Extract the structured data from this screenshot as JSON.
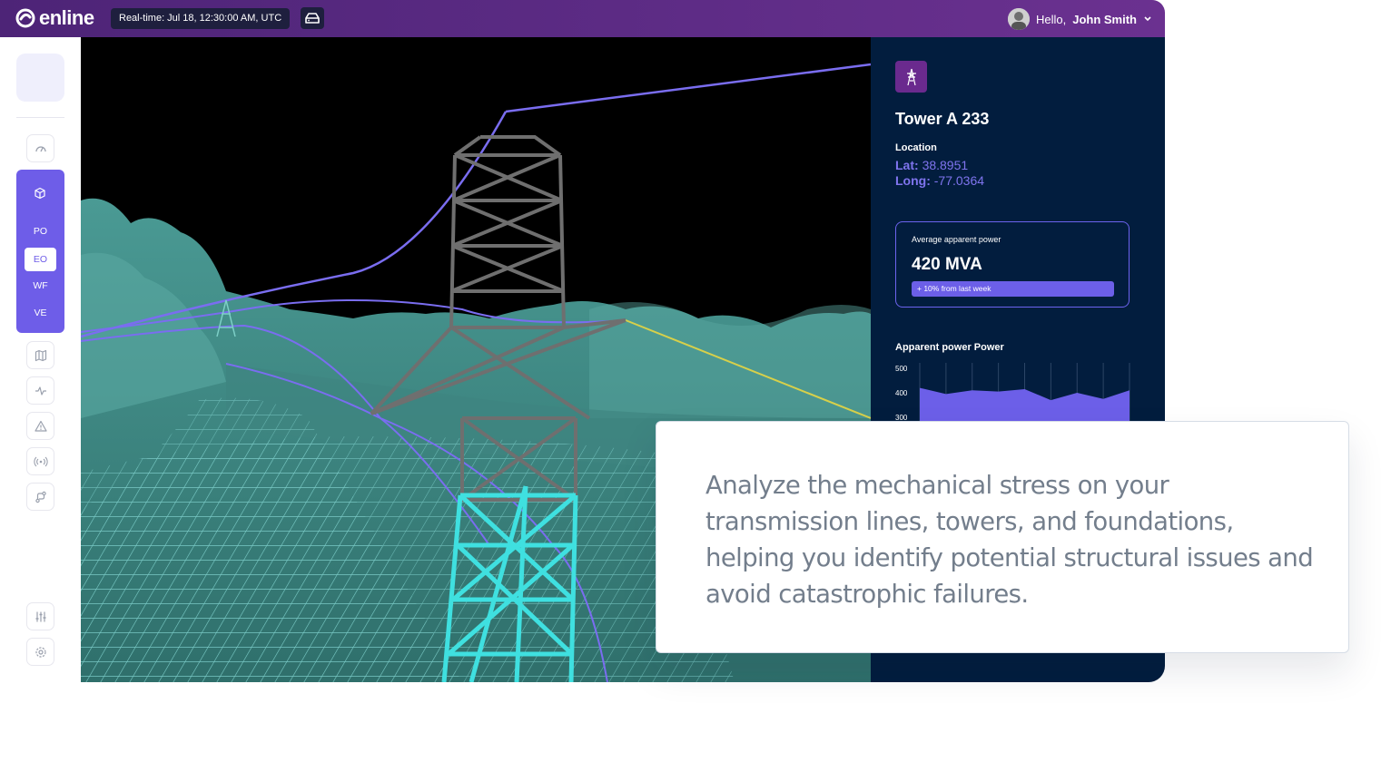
{
  "header": {
    "brand": "enline",
    "realtime": "Real-time: Jul 18, 12:30:00 AM, UTC",
    "greeting": "Hello,",
    "user_name": "John Smith",
    "icons": [
      "enline-logo-icon",
      "drive-icon",
      "chevron-down-icon"
    ]
  },
  "sidebar": {
    "icons": [
      "dashboard-icon",
      "cube-icon",
      "map-icon",
      "activity-icon",
      "alert-icon",
      "broadcast-icon",
      "route-icon",
      "sliders-icon",
      "settings-icon"
    ],
    "sub_items": [
      {
        "label": "PO"
      },
      {
        "label": "EO",
        "active": true
      },
      {
        "label": "WF"
      },
      {
        "label": "VE"
      }
    ]
  },
  "panel": {
    "title": "Tower A 233",
    "location_label": "Location",
    "lat_label": "Lat:",
    "lat_value": "38.8951",
    "long_label": "Long:",
    "long_value": "-77.0364",
    "power_card": {
      "label": "Average apparent power",
      "value": "420 MVA",
      "badge": "+ 10% from last week"
    }
  },
  "chart_data": {
    "type": "area",
    "title": "Apparent power Power",
    "y_ticks": [
      "500",
      "400",
      "300"
    ],
    "values": [
      420,
      395,
      410,
      405,
      415,
      370,
      400,
      375,
      410
    ],
    "color": "#6c5fe8"
  },
  "overlay": {
    "text": "Analyze the mechanical stress on your transmission lines, towers, and foundations, helping you identify potential structural issues and avoid catastrophic failures."
  },
  "colors": {
    "topbar": "#5e2c86",
    "accent": "#6e5de8",
    "panel_bg": "#021d3e",
    "pointcloud": "#3e8a86",
    "tower_highlight": "#3fe0e0"
  }
}
